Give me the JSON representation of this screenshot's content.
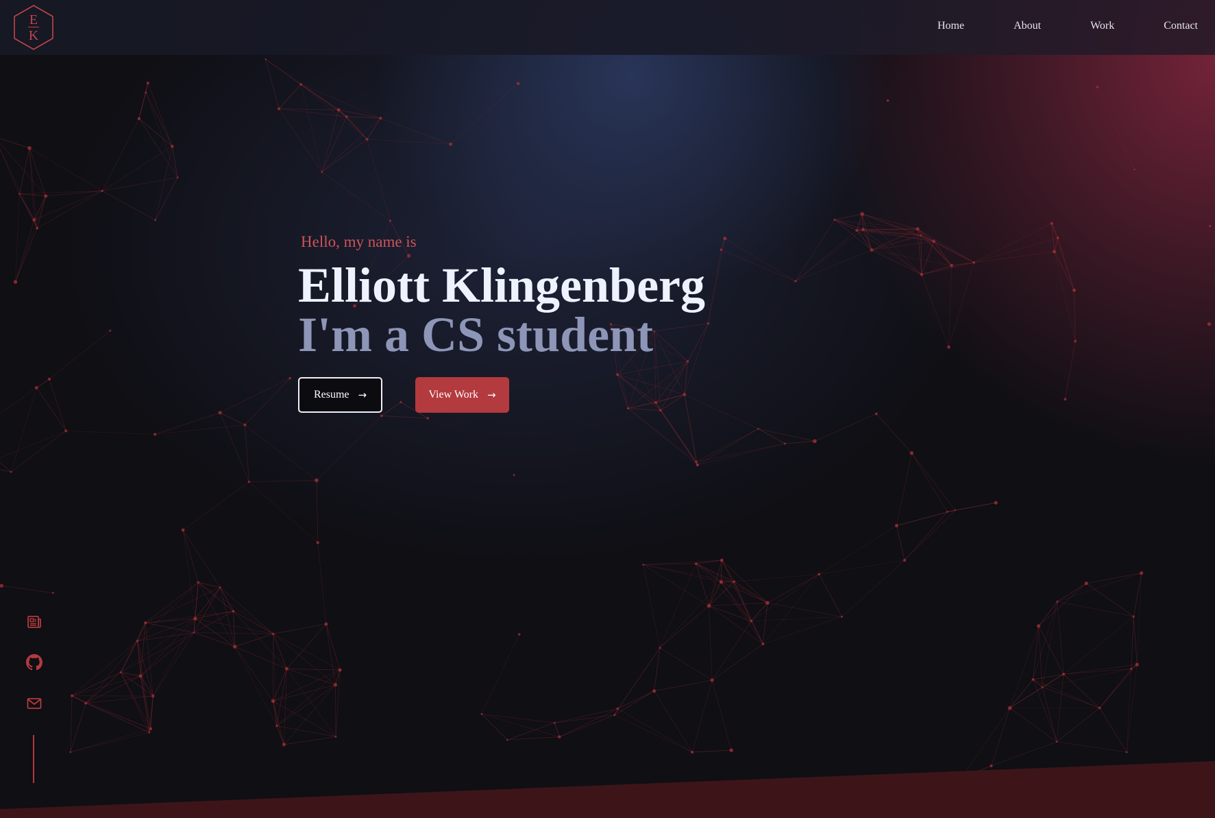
{
  "logo": {
    "letter_top": "E",
    "letter_bottom": "K",
    "icon": "hexagon-monogram-logo"
  },
  "nav": {
    "items": [
      {
        "label": "Home"
      },
      {
        "label": "About"
      },
      {
        "label": "Work"
      },
      {
        "label": "Contact"
      }
    ]
  },
  "hero": {
    "greeting": "Hello, my name is",
    "name": "Elliott Klingenberg",
    "tagline": "I'm a CS student",
    "resume_button": {
      "label": "Resume",
      "icon": "arrow-right-icon"
    },
    "work_button": {
      "label": "View Work",
      "icon": "arrow-right-icon"
    }
  },
  "social": {
    "items": [
      {
        "icon": "resume-document-icon"
      },
      {
        "icon": "github-icon"
      },
      {
        "icon": "mail-icon"
      }
    ]
  },
  "colors": {
    "accent": "#b33a3e",
    "accent_text": "#d0535a",
    "background": "#0f0f14",
    "name_text": "#eef2ff",
    "tagline_text": "#8e96b8",
    "network_lines": "#8a2a30"
  }
}
